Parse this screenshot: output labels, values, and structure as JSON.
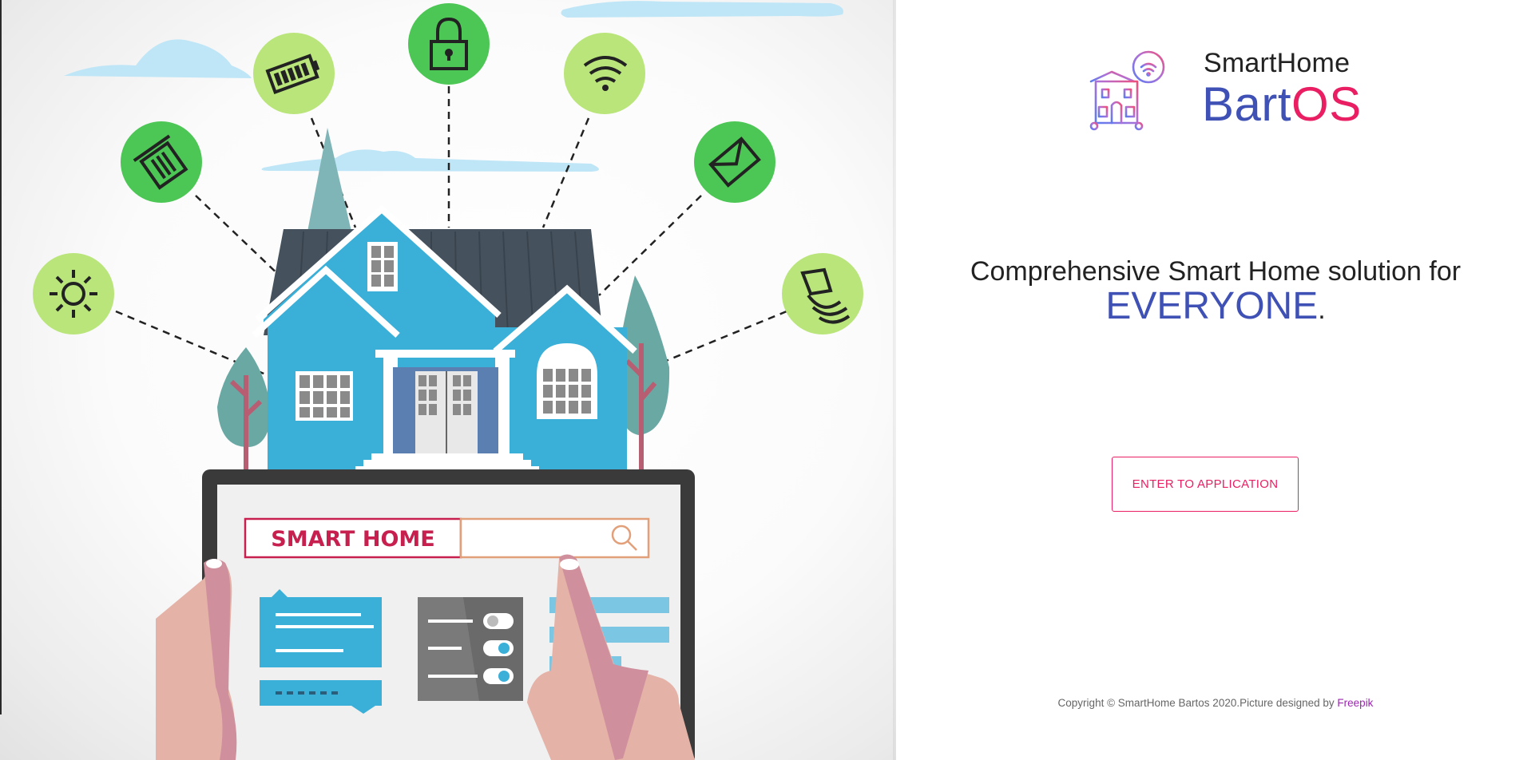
{
  "illustration": {
    "screen_text": "SMART HOME",
    "icons": [
      "sun-icon",
      "trash-icon",
      "battery-icon",
      "lock-icon",
      "wifi-icon",
      "mail-icon",
      "alarm-icon"
    ]
  },
  "brand": {
    "top": "SmartHome",
    "bart": "Bart",
    "os": "OS"
  },
  "tagline": {
    "line1": "Comprehensive Smart Home solution for",
    "line2": "EVERYONE",
    "punct": "."
  },
  "actions": {
    "enter_label": "ENTER TO APPLICATION"
  },
  "footer": {
    "copyright": "Copyright © SmartHome Bartos 2020.Picture designed by ",
    "link": "Freepik"
  },
  "colors": {
    "primary": "#3f51b5",
    "accent": "#e91e63",
    "link": "#9c27b0"
  }
}
